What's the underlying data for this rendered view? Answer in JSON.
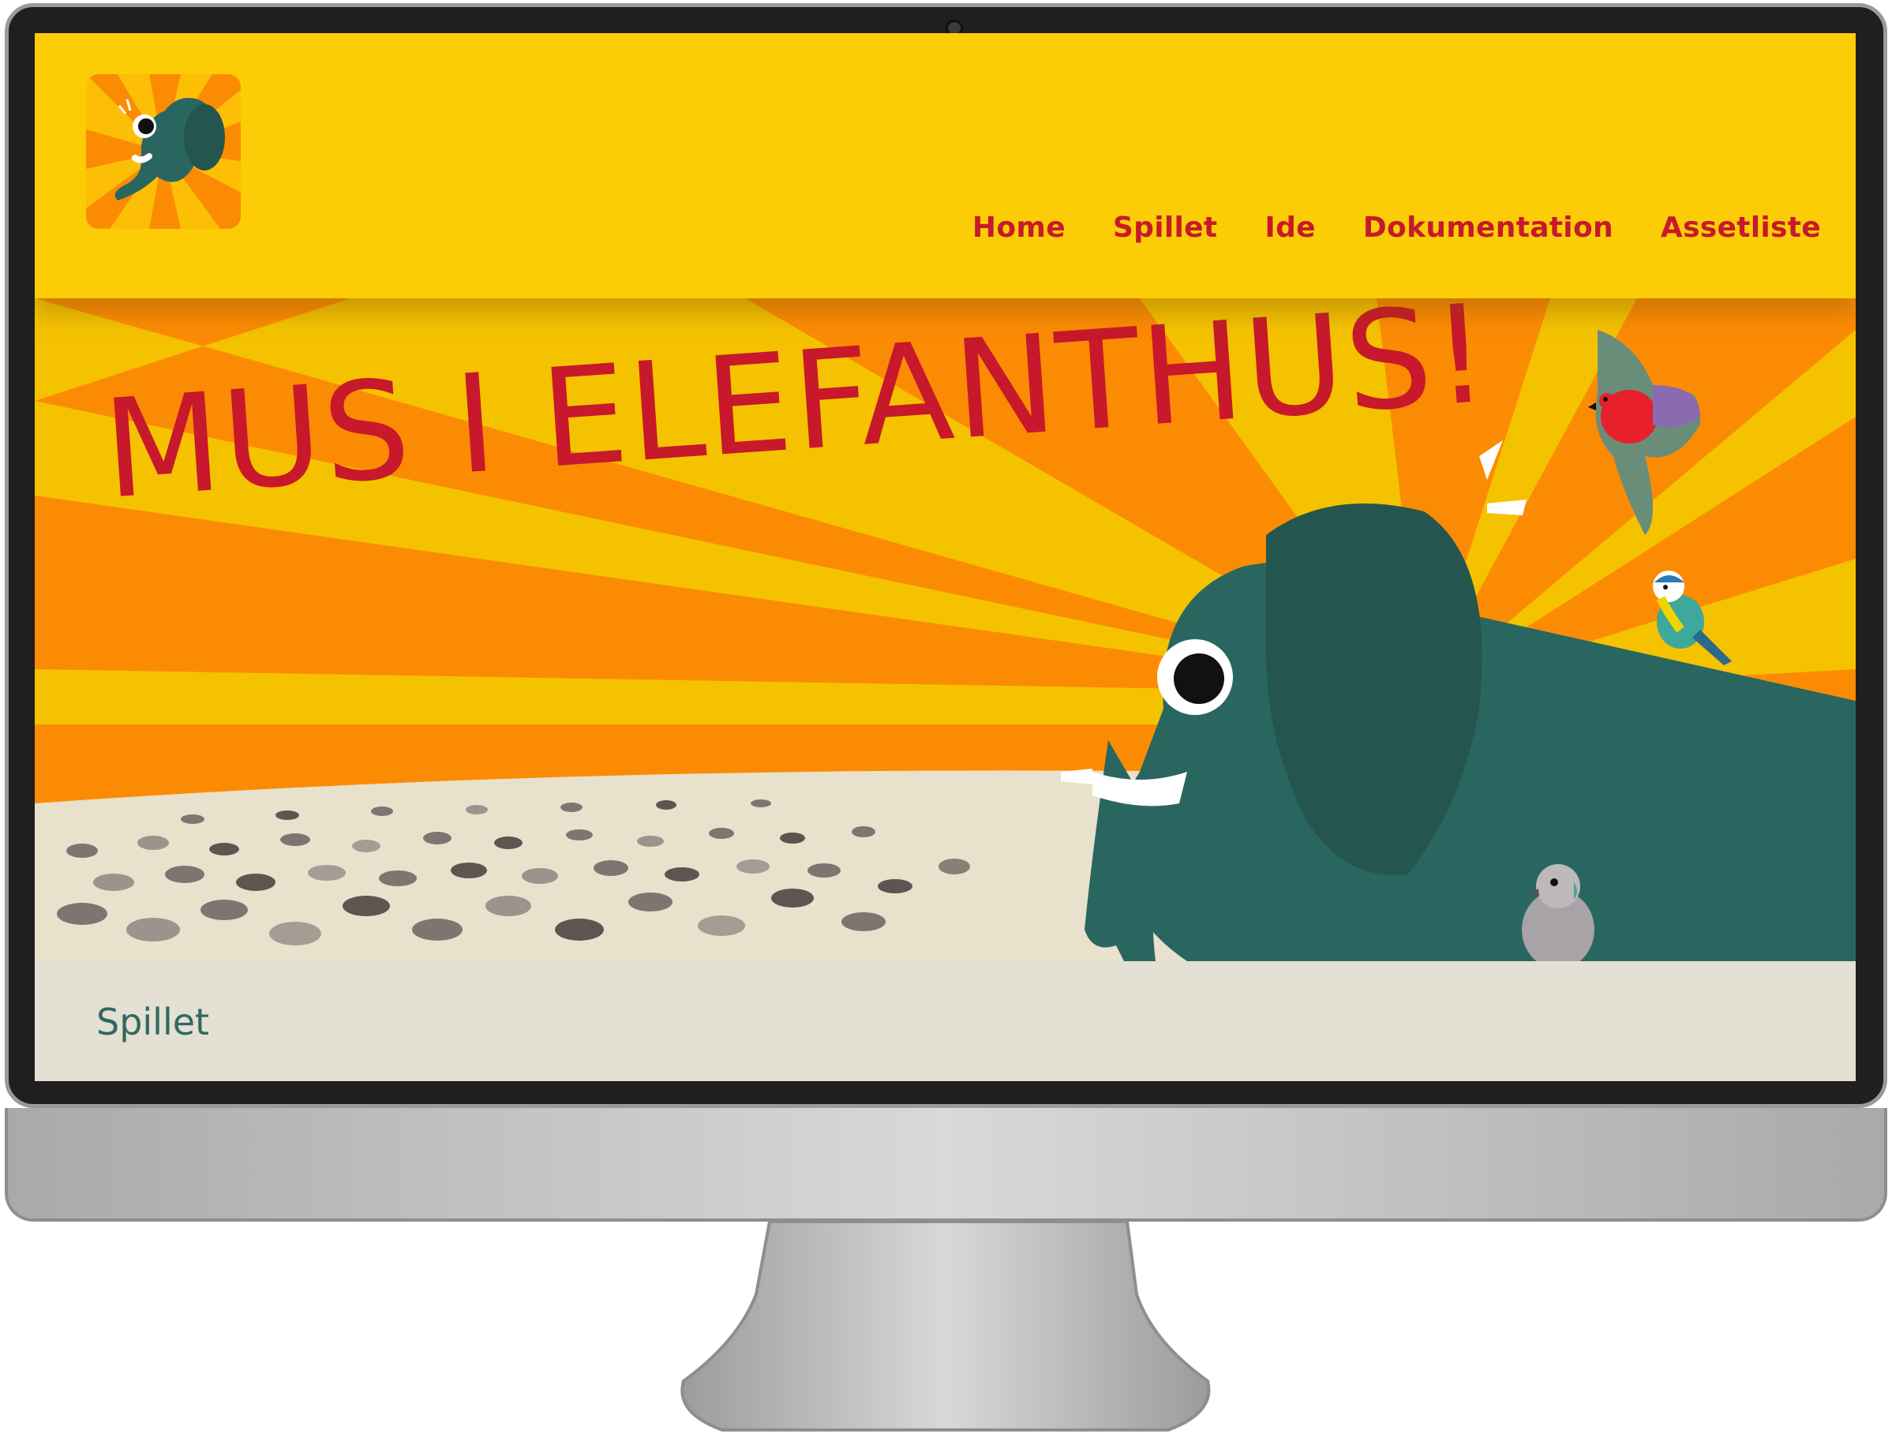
{
  "site": {
    "nav": [
      {
        "label": "Home"
      },
      {
        "label": "Spillet"
      },
      {
        "label": "Ide"
      },
      {
        "label": "Dokumentation"
      },
      {
        "label": "Assetliste"
      }
    ]
  },
  "hero": {
    "title": "MUS I ELEFANTHUS!"
  },
  "section": {
    "title": "Spillet"
  },
  "icons": {
    "logo": "elephant-logo",
    "hero_characters": [
      "elephant",
      "parrot",
      "blue-tit",
      "pigeon",
      "mouse-herd"
    ]
  },
  "colors": {
    "header_bg": "#fccd06",
    "nav_text": "#c7192b",
    "hero_orange": "#fc8b04",
    "hero_yellow": "#f5c200",
    "ground": "#e8e1cc",
    "elephant": "#2a6660",
    "elephant_ear": "#25554f",
    "section_bg": "#e4e0d3",
    "section_title": "#2e6961"
  }
}
